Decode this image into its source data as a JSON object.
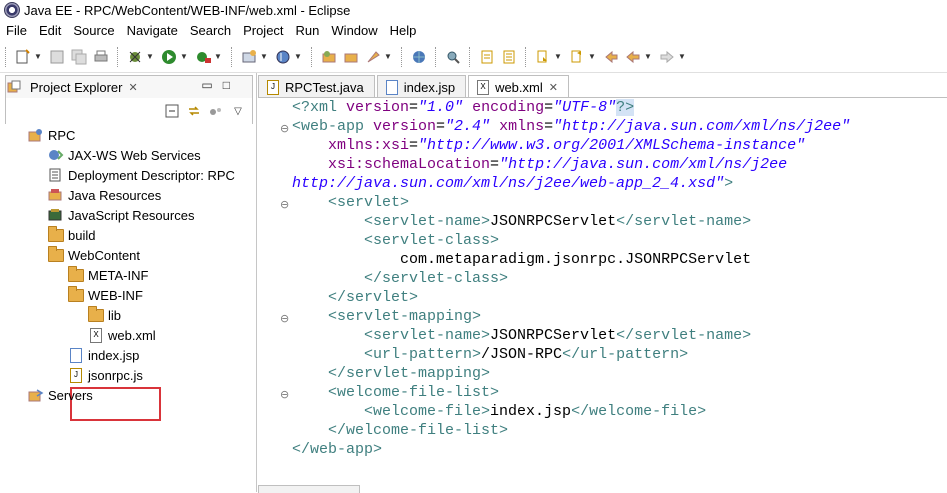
{
  "window": {
    "title": "Java EE - RPC/WebContent/WEB-INF/web.xml - Eclipse"
  },
  "menu": [
    "File",
    "Edit",
    "Source",
    "Navigate",
    "Search",
    "Project",
    "Run",
    "Window",
    "Help"
  ],
  "explorer": {
    "tab_label": "Project Explorer",
    "tree": [
      {
        "label": "RPC",
        "icon": "project-icon"
      },
      {
        "label": "JAX-WS Web Services",
        "icon": "webservice-icon"
      },
      {
        "label": "Deployment Descriptor: RPC",
        "icon": "descriptor-icon"
      },
      {
        "label": "Java Resources",
        "icon": "java-resources-icon"
      },
      {
        "label": "JavaScript Resources",
        "icon": "javascript-resources-icon"
      },
      {
        "label": "build",
        "icon": "folder-icon"
      },
      {
        "label": "WebContent",
        "icon": "folder-icon"
      },
      {
        "label": "META-INF",
        "icon": "folder-icon"
      },
      {
        "label": "WEB-INF",
        "icon": "folder-icon"
      },
      {
        "label": "lib",
        "icon": "folder-icon"
      },
      {
        "label": "web.xml",
        "icon": "xml-file-icon"
      },
      {
        "label": "index.jsp",
        "icon": "jsp-file-icon"
      },
      {
        "label": "jsonrpc.js",
        "icon": "js-file-icon"
      },
      {
        "label": "Servers",
        "icon": "servers-icon"
      }
    ]
  },
  "editor": {
    "tabs": [
      {
        "label": "RPCTest.java",
        "active": false
      },
      {
        "label": "index.jsp",
        "active": false
      },
      {
        "label": "web.xml",
        "active": true
      }
    ],
    "xml": {
      "decl_open": "<?xml ",
      "decl_version_attr": "version",
      "decl_version_val": "\"1.0\"",
      "decl_encoding_attr": "encoding",
      "decl_encoding_val": "\"UTF-8\"",
      "decl_close": "?>",
      "webapp_open": "<web-app ",
      "webapp_version_attr": "version",
      "webapp_version_val": "\"2.4\"",
      "webapp_xmlns_attr": "xmlns",
      "webapp_xmlns_val": "\"http://java.sun.com/xml/ns/j2ee\"",
      "xmlns_xsi_attr": "xmlns:xsi",
      "xmlns_xsi_val": "\"http://www.w3.org/2001/XMLSchema-instance\"",
      "schema_loc_attr": "xsi:schemaLocation",
      "schema_loc_val1": "\"http://java.sun.com/xml/ns/j2ee",
      "schema_loc_val2": "http://java.sun.com/xml/ns/j2ee/web-app_2_4.xsd\"",
      "gt": ">",
      "servlet_open": "<servlet>",
      "servlet_name_open": "<servlet-name>",
      "servlet_name_text": "JSONRPCServlet",
      "servlet_name_close": "</servlet-name>",
      "servlet_class_open": "<servlet-class>",
      "servlet_class_text": "com.metaparadigm.jsonrpc.JSONRPCServlet",
      "servlet_class_close": "</servlet-class>",
      "servlet_close": "</servlet>",
      "mapping_open": "<servlet-mapping>",
      "mapping_name_text": "JSONRPCServlet",
      "url_pattern_open": "<url-pattern>",
      "url_pattern_text": "/JSON-RPC",
      "url_pattern_close": "</url-pattern>",
      "mapping_close": "</servlet-mapping>",
      "welcome_list_open": "<welcome-file-list>",
      "welcome_file_open": "<welcome-file>",
      "welcome_file_text": "index.jsp",
      "welcome_file_close": "</welcome-file>",
      "welcome_list_close": "</welcome-file-list>",
      "webapp_close": "</web-app>"
    }
  },
  "colors": {
    "tag": "#3f7f7f",
    "attr_name": "#7f007f",
    "attr_value": "#2a00ff",
    "highlight_box": "#d9343a"
  }
}
